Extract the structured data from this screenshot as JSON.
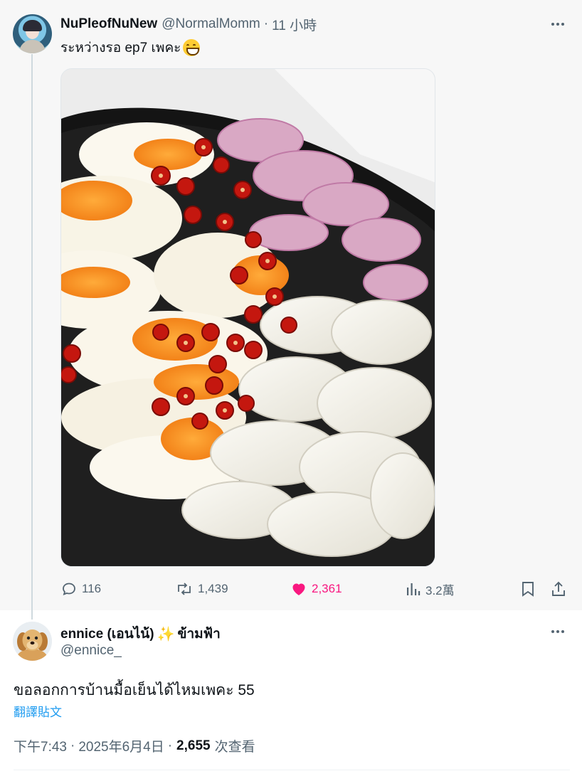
{
  "parent_tweet": {
    "display_name": "NuPleofNuNew",
    "handle": "@NormalMomm",
    "separator": "·",
    "time": "11 小時",
    "text": "ระหว่างรอ ep7 เพคะ",
    "emoji": "grinning-face-with-smiling-eyes-emoji",
    "media_alt": "photo of salted eggs with sliced chili, shallots and onion in a black bowl",
    "actions": {
      "replies": "116",
      "retweets": "1,439",
      "likes": "2,361",
      "views": "3.2萬"
    },
    "liked": true,
    "colors": {
      "like": "#f91880",
      "muted": "#536471"
    }
  },
  "reply_tweet": {
    "display_name": "ennice (เอนไน้)",
    "name_emoji": "✨",
    "name_suffix": "ข้ามฟ้า",
    "handle": "@ennice_",
    "text": "ขอลอกการบ้านมื้อเย็นได้ไหมเพคะ 55",
    "translate_link": "翻譯貼文",
    "time": "下午7:43",
    "separator": "·",
    "date": "2025年6月4日",
    "view_count": "2,655",
    "view_label": "次查看",
    "colors": {
      "link": "#1d9bf0"
    }
  }
}
